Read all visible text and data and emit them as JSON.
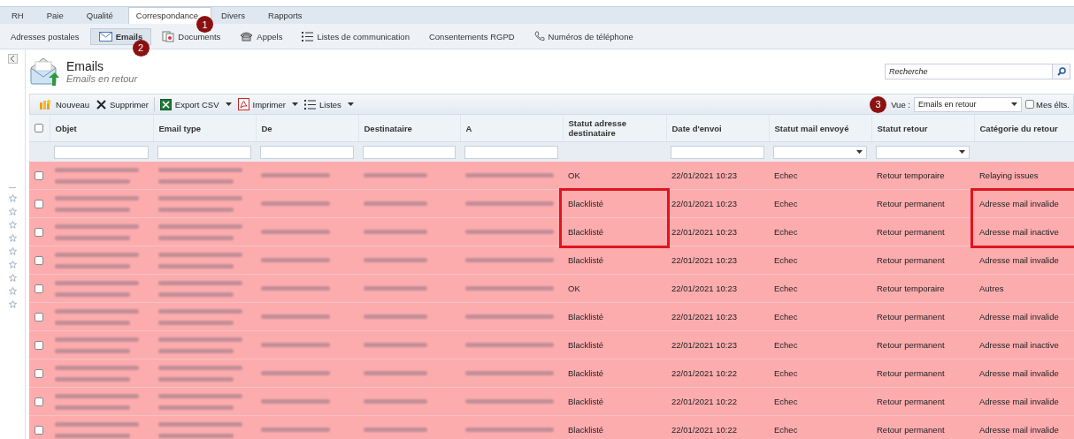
{
  "tabs": [
    {
      "label": "RH",
      "selected": false
    },
    {
      "label": "Paie",
      "selected": false
    },
    {
      "label": "Qualité",
      "selected": false
    },
    {
      "label": "Correspondance",
      "selected": true,
      "badge": "1"
    },
    {
      "label": "Divers",
      "selected": false
    },
    {
      "label": "Rapports",
      "selected": false
    }
  ],
  "subtabs": [
    {
      "label": "Adresses postales",
      "selected": false
    },
    {
      "label": "Emails",
      "selected": true,
      "badge": "2"
    },
    {
      "label": "Documents",
      "selected": false
    },
    {
      "label": "Appels",
      "selected": false
    },
    {
      "label": "Listes de communication",
      "selected": false
    },
    {
      "label": "Consentements RGPD",
      "selected": false
    },
    {
      "label": "Numéros de téléphone",
      "selected": false
    }
  ],
  "header": {
    "title": "Emails",
    "subtitle": "Emails en retour"
  },
  "search": {
    "placeholder": "Recherche"
  },
  "toolbar": [
    {
      "label": "Nouveau"
    },
    {
      "label": "Supprimer"
    },
    {
      "label": "Export CSV"
    },
    {
      "label": "Imprimer"
    },
    {
      "label": "Listes"
    }
  ],
  "view": {
    "label": "Vue :",
    "value": "Emails en retour",
    "badge": "3"
  },
  "mine": {
    "label": "Mes élts.",
    "checked": false
  },
  "table": {
    "all_checked": false,
    "columns": [
      {
        "label": "Objet"
      },
      {
        "label": "Email type"
      },
      {
        "label": "De"
      },
      {
        "label": "Destinataire"
      },
      {
        "label": "A"
      },
      {
        "label": "Statut adresse destinataire"
      },
      {
        "label": "Date d'envoi"
      },
      {
        "label": "Statut mail envoyé"
      },
      {
        "label": "Statut retour"
      },
      {
        "label": "Catégorie du retour"
      }
    ],
    "rows": [
      {
        "checked": false,
        "statut_adresse": "OK",
        "date": "22/01/2021 10:23",
        "statut_mail": "Echec",
        "statut_retour": "Retour temporaire",
        "categorie": "Relaying issues",
        "marked": false
      },
      {
        "checked": false,
        "statut_adresse": "Blacklisté",
        "date": "22/01/2021 10:23",
        "statut_mail": "Echec",
        "statut_retour": "Retour permanent",
        "categorie": "Adresse mail invalide",
        "marked": true
      },
      {
        "checked": false,
        "statut_adresse": "Blacklisté",
        "date": "22/01/2021 10:23",
        "statut_mail": "Echec",
        "statut_retour": "Retour permanent",
        "categorie": "Adresse mail inactive",
        "marked": true
      },
      {
        "checked": false,
        "statut_adresse": "Blacklisté",
        "date": "22/01/2021 10:23",
        "statut_mail": "Echec",
        "statut_retour": "Retour permanent",
        "categorie": "Adresse mail invalide",
        "marked": false
      },
      {
        "checked": false,
        "statut_adresse": "OK",
        "date": "22/01/2021 10:23",
        "statut_mail": "Echec",
        "statut_retour": "Retour temporaire",
        "categorie": "Autres",
        "marked": false
      },
      {
        "checked": false,
        "statut_adresse": "Blacklisté",
        "date": "22/01/2021 10:23",
        "statut_mail": "Echec",
        "statut_retour": "Retour permanent",
        "categorie": "Adresse mail invalide",
        "marked": false
      },
      {
        "checked": false,
        "statut_adresse": "Blacklisté",
        "date": "22/01/2021 10:23",
        "statut_mail": "Echec",
        "statut_retour": "Retour permanent",
        "categorie": "Adresse mail inactive",
        "marked": false
      },
      {
        "checked": false,
        "statut_adresse": "Blacklisté",
        "date": "22/01/2021 10:22",
        "statut_mail": "Echec",
        "statut_retour": "Retour permanent",
        "categorie": "Adresse mail invalide",
        "marked": false
      },
      {
        "checked": false,
        "statut_adresse": "Blacklisté",
        "date": "22/01/2021 10:22",
        "statut_mail": "Echec",
        "statut_retour": "Retour permanent",
        "categorie": "Adresse mail invalide",
        "marked": false
      },
      {
        "checked": false,
        "statut_adresse": "Blacklisté",
        "date": "22/01/2021 10:22",
        "statut_mail": "Echec",
        "statut_retour": "Retour permanent",
        "categorie": "Adresse mail invalide",
        "marked": false
      }
    ]
  }
}
